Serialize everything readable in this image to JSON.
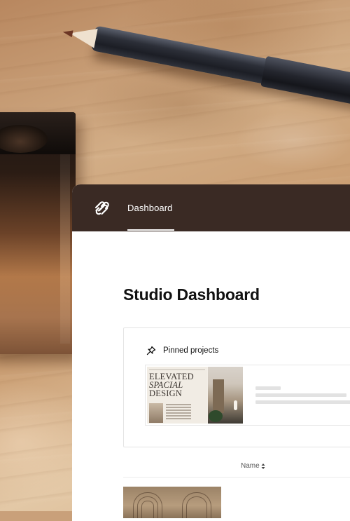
{
  "header": {
    "logo_icon": "squarespace-logo-icon",
    "tab_label": "Dashboard"
  },
  "main": {
    "title": "Studio Dashboard"
  },
  "pinned": {
    "icon": "pin-icon",
    "label": "Pinned projects",
    "project": {
      "thumbnail_heading_line1": "ELEVATED",
      "thumbnail_heading_line2": "SPACIAL",
      "thumbnail_heading_line3": "DESIGN"
    }
  },
  "table": {
    "column_name": "Name",
    "sort_icon": "sort-arrows-icon"
  },
  "colors": {
    "topbar": "#3a2a24",
    "card_bg": "#ffffff",
    "text": "#111111"
  }
}
